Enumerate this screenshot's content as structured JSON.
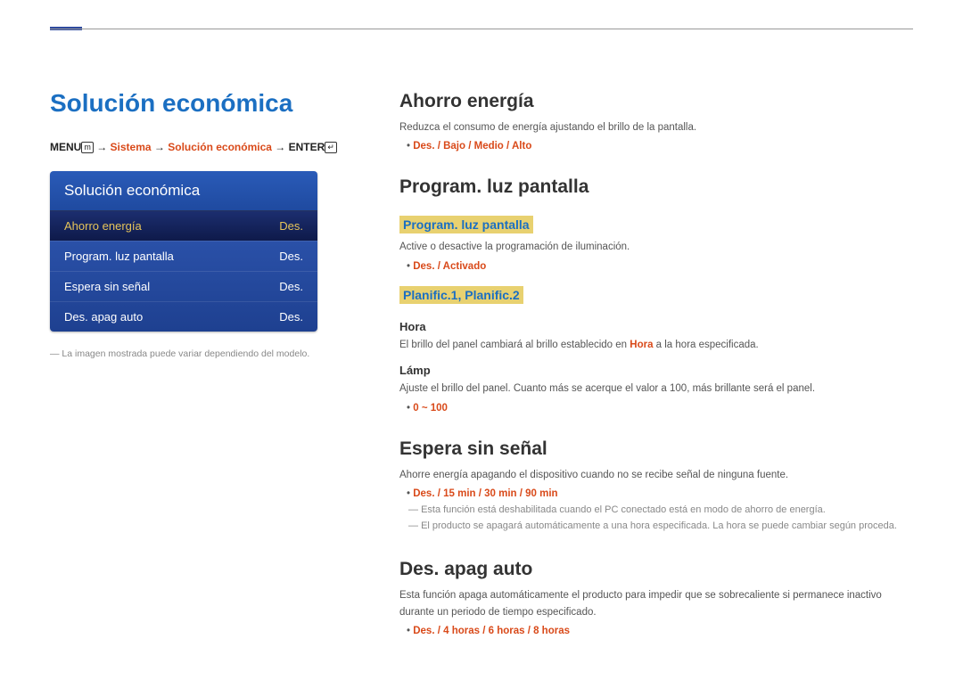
{
  "page_title": "Solución económica",
  "breadcrumb": {
    "key1": "MENU",
    "sep": " → ",
    "step1": "Sistema",
    "step2": "Solución económica",
    "key2": "ENTER"
  },
  "osd": {
    "header": "Solución económica",
    "rows": [
      {
        "label": "Ahorro energía",
        "value": "Des.",
        "selected": true
      },
      {
        "label": "Program. luz pantalla",
        "value": "Des.",
        "selected": false
      },
      {
        "label": "Espera sin señal",
        "value": "Des.",
        "selected": false
      },
      {
        "label": "Des. apag auto",
        "value": "Des.",
        "selected": false
      }
    ]
  },
  "left_note": "La imagen mostrada puede variar dependiendo del modelo.",
  "sections": {
    "s1": {
      "title": "Ahorro energía",
      "desc": "Reduzca el consumo de energía ajustando el brillo de la pantalla.",
      "options": "Des. / Bajo / Medio / Alto"
    },
    "s2": {
      "title": "Program. luz pantalla",
      "sub1": "Program. luz pantalla",
      "sub1_desc": "Active o desactive la programación de iluminación.",
      "sub1_options": "Des. / Activado",
      "sub2": "Planific.1, Planific.2",
      "hora_title": "Hora",
      "hora_desc_pre": "El brillo del panel cambiará al brillo establecido en ",
      "hora_desc_em": "Hora",
      "hora_desc_post": " a la hora especificada.",
      "lamp_title": "Lámp",
      "lamp_desc": "Ajuste el brillo del panel. Cuanto más se acerque el valor a 100, más brillante será el panel.",
      "lamp_options": "0 ~ 100"
    },
    "s3": {
      "title": "Espera sin señal",
      "desc": "Ahorre energía apagando el dispositivo cuando no se recibe señal de ninguna fuente.",
      "options": "Des. / 15 min / 30 min / 90 min",
      "note1": "Esta función está deshabilitada cuando el PC conectado está en modo de ahorro de energía.",
      "note2": "El producto se apagará automáticamente a una hora especificada. La hora se puede cambiar según proceda."
    },
    "s4": {
      "title": "Des. apag auto",
      "desc": "Esta función apaga automáticamente el producto para impedir que se sobrecaliente si permanece inactivo durante un periodo de tiempo especificado.",
      "options": "Des. / 4 horas / 6 horas / 8 horas"
    }
  }
}
